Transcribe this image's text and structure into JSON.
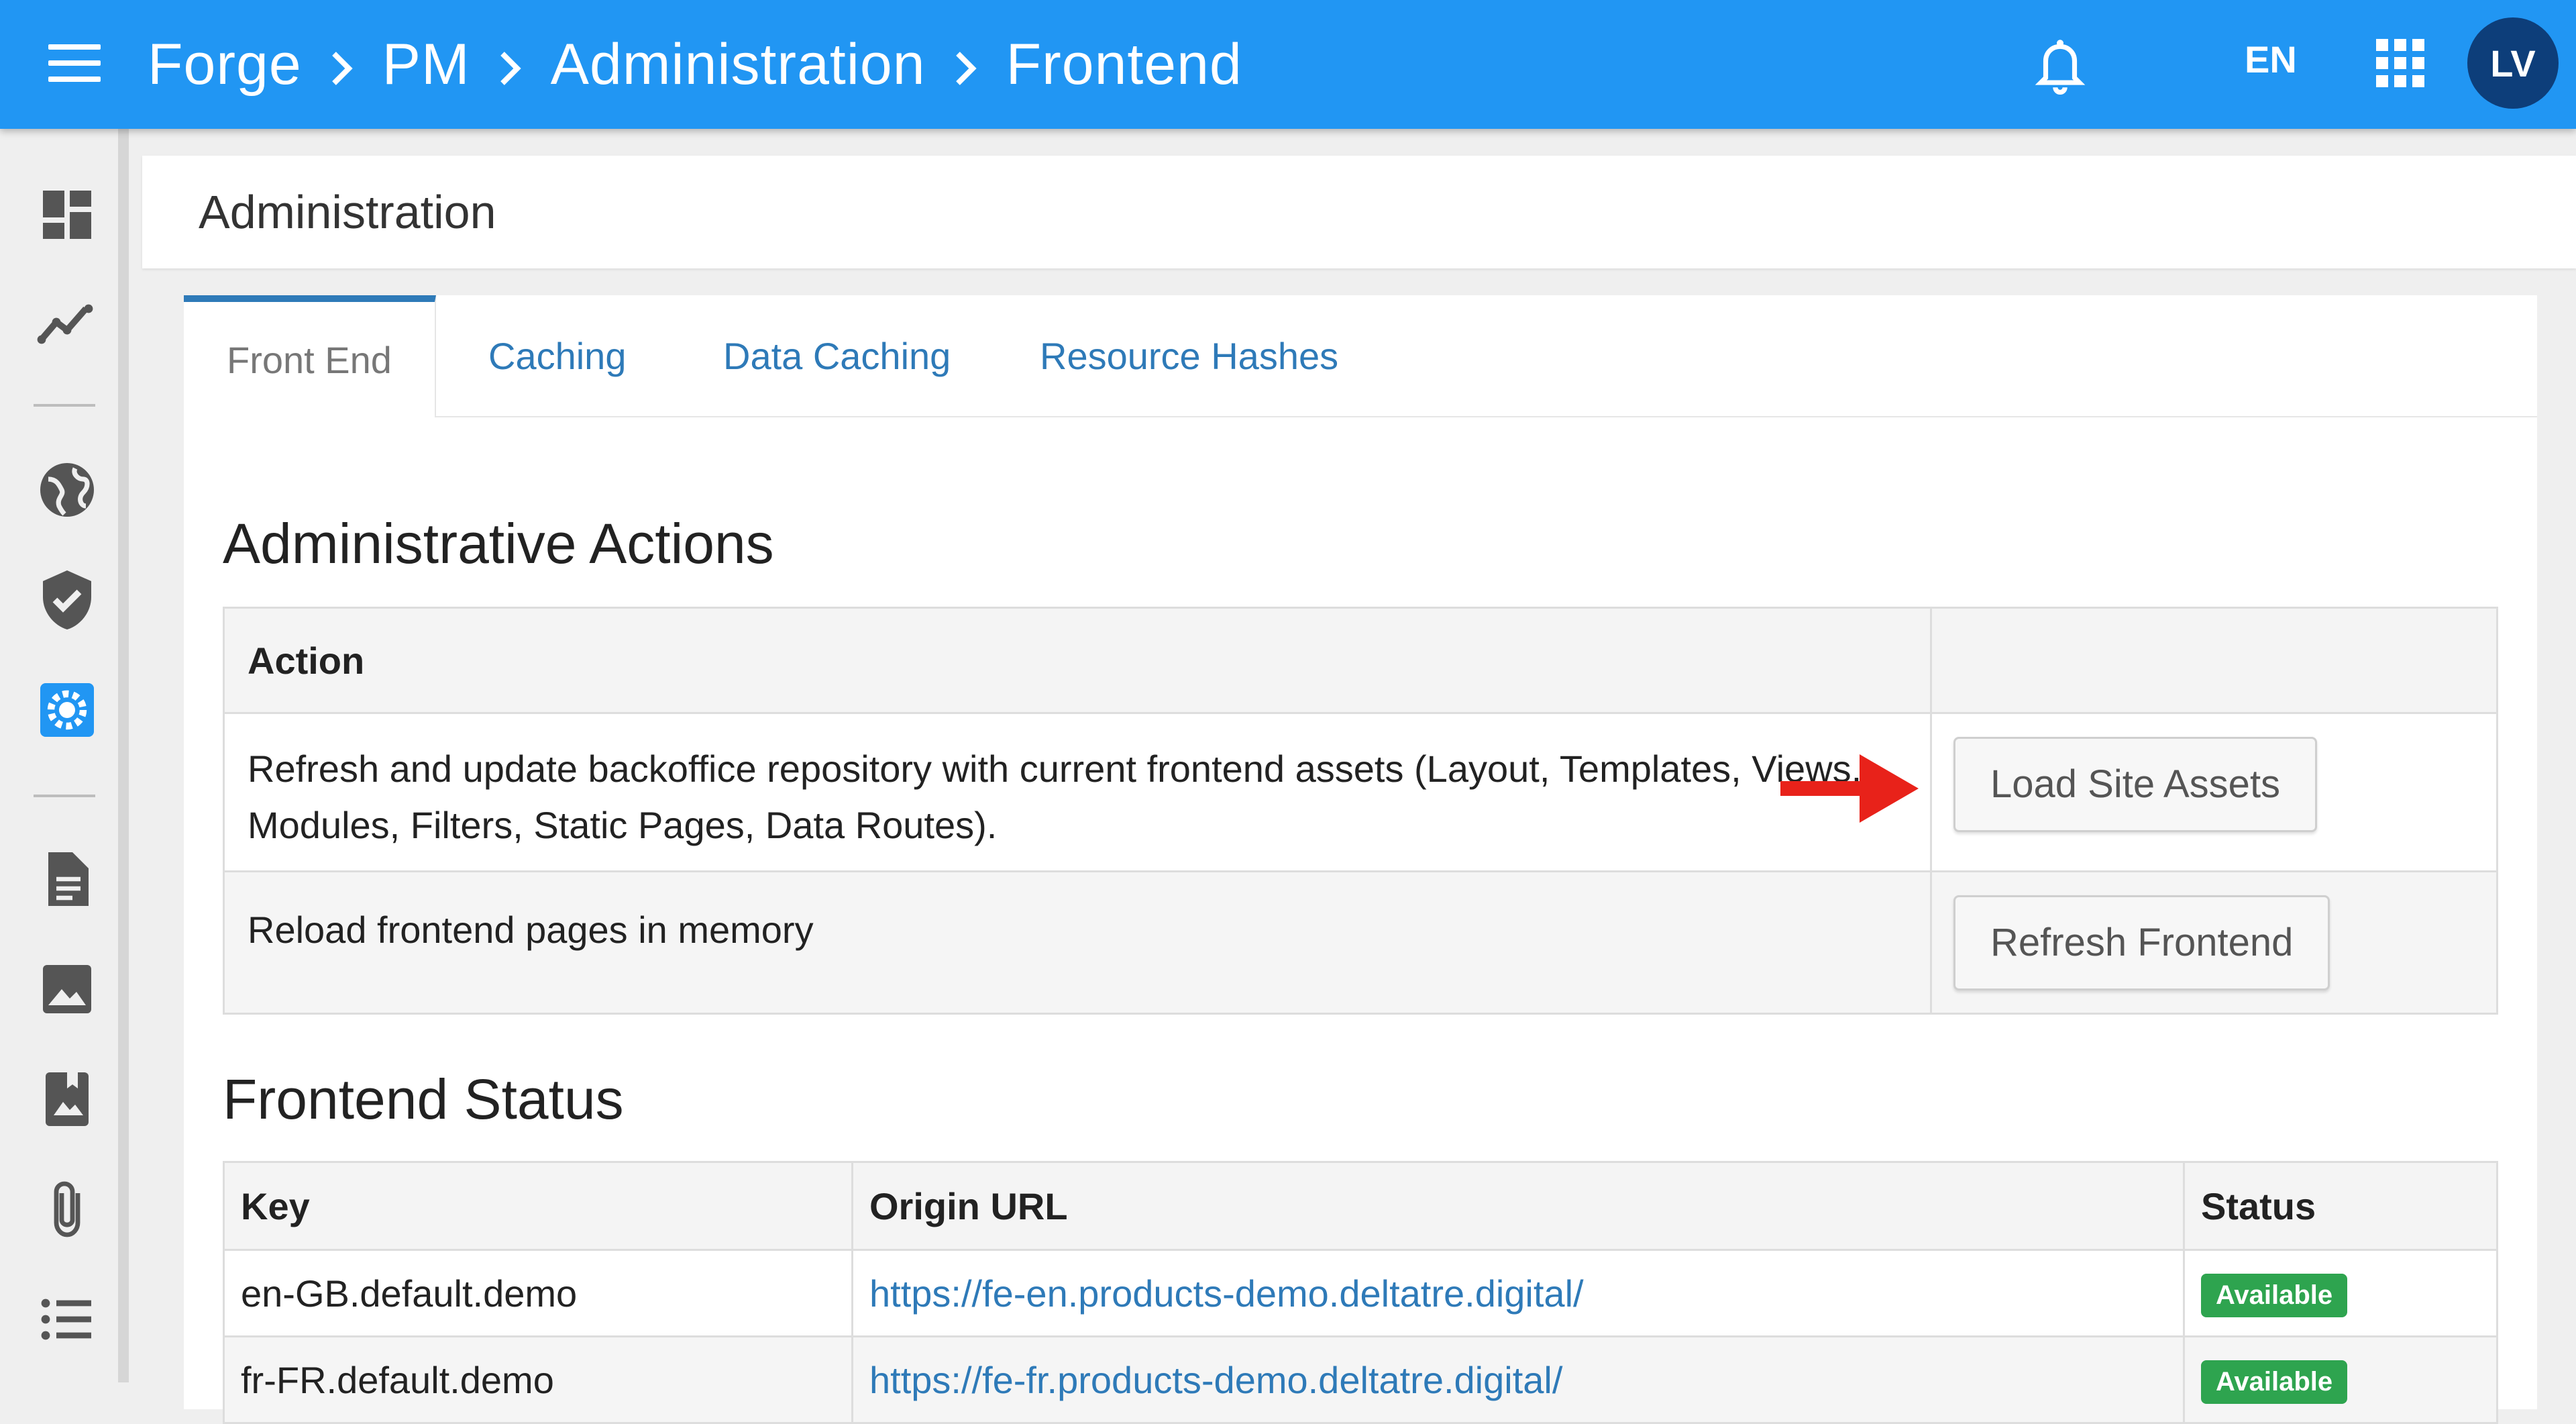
{
  "header": {
    "breadcrumb": [
      "Forge",
      "PM",
      "Administration",
      "Frontend"
    ],
    "language": "EN",
    "user_initials": "LV",
    "icons": [
      "menu-icon",
      "chevron-right-icon",
      "bell-icon",
      "apps-grid-icon"
    ]
  },
  "sidebar": {
    "items": [
      {
        "icon": "dashboard-icon"
      },
      {
        "icon": "analytics-icon"
      },
      {
        "icon": "globe-icon"
      },
      {
        "icon": "shield-check-icon"
      },
      {
        "icon": "settings-icon",
        "active": true
      },
      {
        "icon": "document-icon"
      },
      {
        "icon": "image-icon"
      },
      {
        "icon": "photo-album-icon"
      },
      {
        "icon": "attachment-icon"
      },
      {
        "icon": "list-icon"
      }
    ],
    "active_color": "#2196f3"
  },
  "page": {
    "title": "Administration"
  },
  "tabs": [
    {
      "label": "Front End",
      "active": true
    },
    {
      "label": "Caching"
    },
    {
      "label": "Data Caching"
    },
    {
      "label": "Resource Hashes"
    }
  ],
  "actions_section": {
    "title": "Administrative Actions",
    "columns": [
      "Action",
      ""
    ],
    "rows": [
      {
        "description": "Refresh and update backoffice repository with current frontend assets (Layout, Templates, Views, Modules, Filters, Static Pages, Data Routes).",
        "button": "Load Site Assets"
      },
      {
        "description": "Reload frontend pages in memory",
        "button": "Refresh Frontend"
      }
    ]
  },
  "status_section": {
    "title": "Frontend Status",
    "columns": [
      "Key",
      "Origin URL",
      "Status"
    ],
    "rows": [
      {
        "key": "en-GB.default.demo",
        "url": "https://fe-en.products-demo.deltatre.digital/",
        "status": "Available"
      },
      {
        "key": "fr-FR.default.demo",
        "url": "https://fe-fr.products-demo.deltatre.digital/",
        "status": "Available"
      }
    ]
  },
  "colors": {
    "topbar": "#2196f3",
    "link": "#2e7ab8",
    "badge": "#2ea44f",
    "annotation_arrow": "#e8221a"
  }
}
